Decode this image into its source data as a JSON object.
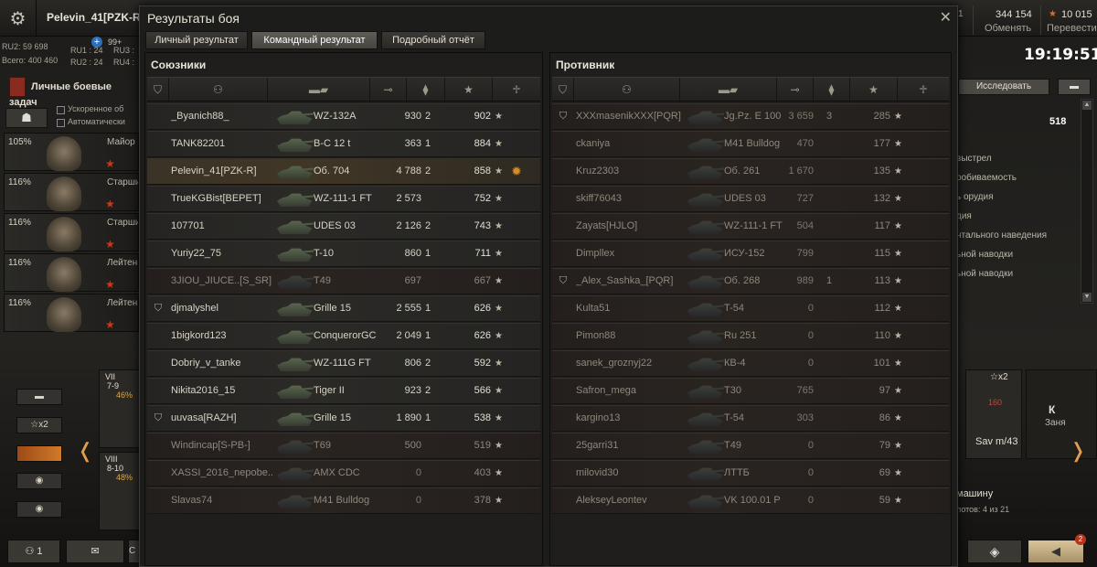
{
  "player": {
    "name": "Pelevin_41[PZK-R]",
    "stat1": "RU2: 59 698",
    "stat2": "Всего: 400 460",
    "ru1": "RU1 : 24",
    "ru2": "RU2 : 24",
    "ru3": "RU3 :",
    "ru4": "RU4 :",
    "plus_count": "99+"
  },
  "left_ui": {
    "missions_label": "Личные боевые задач",
    "checkbox1": "Ускоренное об",
    "checkbox2": "Автоматически",
    "crew": [
      {
        "pct": "105%",
        "rank": "Майор"
      },
      {
        "pct": "116%",
        "rank": "Старши"
      },
      {
        "pct": "116%",
        "rank": "Старши"
      },
      {
        "pct": "116%",
        "rank": "Лейтен"
      },
      {
        "pct": "116%",
        "rank": "Лейтен"
      }
    ],
    "filter_x2": "☆x2",
    "vehicles": [
      {
        "tier": "VII",
        "range": "7-9",
        "pct": "46%"
      },
      {
        "tier": "VIII",
        "range": "8-10",
        "pct": "48%"
      }
    ],
    "bottom_count": "1",
    "bottom_stub": "C"
  },
  "right_ui": {
    "gold_partial": "1",
    "credits_value": "344 154",
    "credits_label": "Обменять",
    "xp_value": "10 015",
    "xp_label": "Перевести",
    "clock": "19:19:51",
    "research": "Исследовать",
    "xp_count": "518",
    "lines": [
      "выстрел",
      "робиваемость",
      "ь орудия",
      "дия",
      "нтального наведения",
      "ьной наводки",
      "ьной наводки"
    ],
    "card_x2": "☆x2",
    "card_160": "160",
    "card_name": "Sav m/43",
    "card2_k": "К",
    "card2_z": "Заня",
    "mashinu": "машину",
    "slots": "лотов: 4 из 21",
    "notif": "2"
  },
  "dialog": {
    "title": "Результаты боя",
    "tabs": [
      "Личный результат",
      "Командный результат",
      "Подробный отчёт"
    ],
    "allies_title": "Союзники",
    "enemies_title": "Противник"
  },
  "allies": [
    {
      "name": "_Byanich88_",
      "tank": "WZ-132A",
      "dmg": "930",
      "kills": "2",
      "xp": "902",
      "plat": "",
      "medal": "",
      "dead": false,
      "me": false
    },
    {
      "name": "TANK82201",
      "tank": "В-С 12 t",
      "dmg": "363",
      "kills": "1",
      "xp": "884",
      "plat": "",
      "medal": "",
      "dead": false,
      "me": false
    },
    {
      "name": "Pelevin_41[PZK-R]",
      "tank": "Об. 704",
      "dmg": "4 788",
      "kills": "2",
      "xp": "858",
      "plat": "",
      "medal": "✹",
      "dead": false,
      "me": true
    },
    {
      "name": "TrueKGBist[BEPET]",
      "tank": "WZ-111-1 FT",
      "dmg": "2 573",
      "kills": "",
      "xp": "752",
      "plat": "",
      "medal": "",
      "dead": false,
      "me": false
    },
    {
      "name": "107701",
      "tank": "UDES 03",
      "dmg": "2 126",
      "kills": "2",
      "xp": "743",
      "plat": "",
      "medal": "",
      "dead": false,
      "me": false
    },
    {
      "name": "Yuriy22_75",
      "tank": "T-10",
      "dmg": "860",
      "kills": "1",
      "xp": "711",
      "plat": "",
      "medal": "",
      "dead": false,
      "me": false
    },
    {
      "name": "3JIOU_JIUCE..[S_SR]",
      "tank": "T49",
      "dmg": "697",
      "kills": "",
      "xp": "667",
      "plat": "",
      "medal": "",
      "dead": true,
      "me": false
    },
    {
      "name": "djmalyshel",
      "tank": "Grille 15",
      "dmg": "2 555",
      "kills": "1",
      "xp": "626",
      "plat": "⛉",
      "medal": "",
      "dead": false,
      "me": false
    },
    {
      "name": "1bigkord123",
      "tank": "ConquerorGC",
      "dmg": "2 049",
      "kills": "1",
      "xp": "626",
      "plat": "",
      "medal": "",
      "dead": false,
      "me": false
    },
    {
      "name": "Dobriy_v_tanke",
      "tank": "WZ-111G FT",
      "dmg": "806",
      "kills": "2",
      "xp": "592",
      "plat": "",
      "medal": "",
      "dead": false,
      "me": false
    },
    {
      "name": "Nikita2016_15",
      "tank": "Tiger II",
      "dmg": "923",
      "kills": "2",
      "xp": "566",
      "plat": "",
      "medal": "",
      "dead": false,
      "me": false
    },
    {
      "name": "uuvasa[RAZH]",
      "tank": "Grille 15",
      "dmg": "1 890",
      "kills": "1",
      "xp": "538",
      "plat": "⛉",
      "medal": "",
      "dead": false,
      "me": false
    },
    {
      "name": "Windincap[S-PB-]",
      "tank": "T69",
      "dmg": "500",
      "kills": "",
      "xp": "519",
      "plat": "",
      "medal": "",
      "dead": true,
      "me": false
    },
    {
      "name": "XASSI_2016_nepobe..",
      "tank": "AMX CDC",
      "dmg": "0",
      "kills": "",
      "xp": "403",
      "plat": "",
      "medal": "",
      "dead": true,
      "me": false
    },
    {
      "name": "Slavas74",
      "tank": "M41 Bulldog",
      "dmg": "0",
      "kills": "",
      "xp": "378",
      "plat": "",
      "medal": "",
      "dead": true,
      "me": false
    }
  ],
  "enemies": [
    {
      "name": "XXXmasenikXXX[PQR]",
      "tank": "Jg.Pz. E 100",
      "dmg": "3 659",
      "kills": "3",
      "xp": "285",
      "plat": "⛉",
      "dead": true
    },
    {
      "name": "ckaniya",
      "tank": "M41 Bulldog",
      "dmg": "470",
      "kills": "",
      "xp": "177",
      "plat": "",
      "dead": true
    },
    {
      "name": "Kruz2303",
      "tank": "Об. 261",
      "dmg": "1 670",
      "kills": "",
      "xp": "135",
      "plat": "",
      "dead": true
    },
    {
      "name": "skiff76043",
      "tank": "UDES 03",
      "dmg": "727",
      "kills": "",
      "xp": "132",
      "plat": "",
      "dead": true
    },
    {
      "name": "Zayats[HJLO]",
      "tank": "WZ-111-1 FT",
      "dmg": "504",
      "kills": "",
      "xp": "117",
      "plat": "",
      "dead": true
    },
    {
      "name": "Dimpllex",
      "tank": "ИСУ-152",
      "dmg": "799",
      "kills": "",
      "xp": "115",
      "plat": "",
      "dead": true
    },
    {
      "name": "_Alex_Sashka_[PQR]",
      "tank": "Об. 268",
      "dmg": "989",
      "kills": "1",
      "xp": "113",
      "plat": "⛉",
      "dead": true
    },
    {
      "name": "Kulta51",
      "tank": "T-54",
      "dmg": "0",
      "kills": "",
      "xp": "112",
      "plat": "",
      "dead": true
    },
    {
      "name": "Pimon88",
      "tank": "Ru 251",
      "dmg": "0",
      "kills": "",
      "xp": "110",
      "plat": "",
      "dead": true
    },
    {
      "name": "sanek_groznyj22",
      "tank": "КВ-4",
      "dmg": "0",
      "kills": "",
      "xp": "101",
      "plat": "",
      "dead": true
    },
    {
      "name": "Safron_mega",
      "tank": "T30",
      "dmg": "765",
      "kills": "",
      "xp": "97",
      "plat": "",
      "dead": true
    },
    {
      "name": "kargino13",
      "tank": "T-54",
      "dmg": "303",
      "kills": "",
      "xp": "86",
      "plat": "",
      "dead": true
    },
    {
      "name": "25garri31",
      "tank": "T49",
      "dmg": "0",
      "kills": "",
      "xp": "79",
      "plat": "",
      "dead": true
    },
    {
      "name": "milovid30",
      "tank": "ЛТТБ",
      "dmg": "0",
      "kills": "",
      "xp": "69",
      "plat": "",
      "dead": true
    },
    {
      "name": "AlekseyLeontev",
      "tank": "VK 100.01 P",
      "dmg": "0",
      "kills": "",
      "xp": "59",
      "plat": "",
      "dead": true
    }
  ],
  "icons": {
    "settings": "gear-icon",
    "close": "close-icon",
    "star": "star-icon",
    "platoon": "platoon-icon",
    "medal": "medal-icon"
  }
}
